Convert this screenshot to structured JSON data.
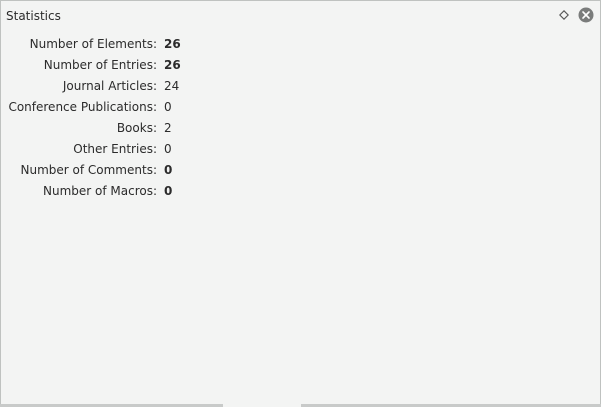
{
  "panel": {
    "title": "Statistics",
    "float_icon": "diamond-float-icon",
    "close_icon": "close-circle-icon"
  },
  "stats": [
    {
      "label": "Number of Elements:",
      "value": "26",
      "bold": true
    },
    {
      "label": "Number of Entries:",
      "value": "26",
      "bold": true
    },
    {
      "label": "Journal Articles:",
      "value": "24",
      "bold": false
    },
    {
      "label": "Conference Publications:",
      "value": "0",
      "bold": false
    },
    {
      "label": "Books:",
      "value": "2",
      "bold": false
    },
    {
      "label": "Other Entries:",
      "value": "0",
      "bold": false
    },
    {
      "label": "Number of Comments:",
      "value": "0",
      "bold": true
    },
    {
      "label": "Number of Macros:",
      "value": "0",
      "bold": true
    }
  ]
}
